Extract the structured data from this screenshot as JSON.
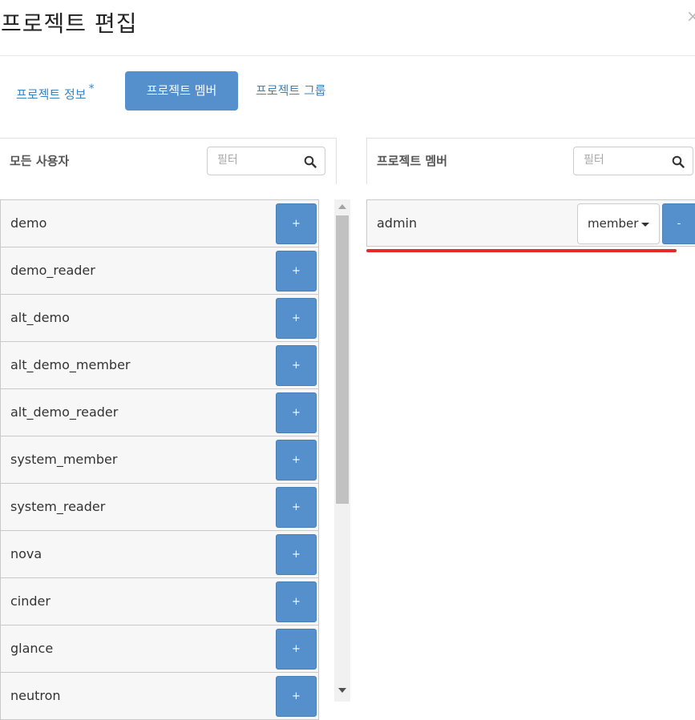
{
  "modal": {
    "title": "프로젝트 편집",
    "close_glyph": "×"
  },
  "tabs": [
    {
      "label": "프로젝트 정보",
      "required_mark": "*",
      "active": false
    },
    {
      "label": "프로젝트 멤버",
      "active": true
    },
    {
      "label": "프로젝트 그룹",
      "active": false
    }
  ],
  "all_users": {
    "title": "모든 사용자",
    "filter_placeholder": "필터",
    "add_label": "+",
    "users": [
      "demo",
      "demo_reader",
      "alt_demo",
      "alt_demo_member",
      "alt_demo_reader",
      "system_member",
      "system_reader",
      "nova",
      "cinder",
      "glance",
      "neutron"
    ]
  },
  "project_members": {
    "title": "프로젝트 멤버",
    "filter_placeholder": "필터",
    "members": [
      {
        "name": "admin",
        "role": "member",
        "remove_label": "-"
      }
    ]
  },
  "colors": {
    "accent": "#5590cd",
    "link": "#3b84c0",
    "annotation": "#e62a2a"
  },
  "icons": {
    "search": "magnifier",
    "close": "x",
    "role_dropdown": "caret-down"
  }
}
